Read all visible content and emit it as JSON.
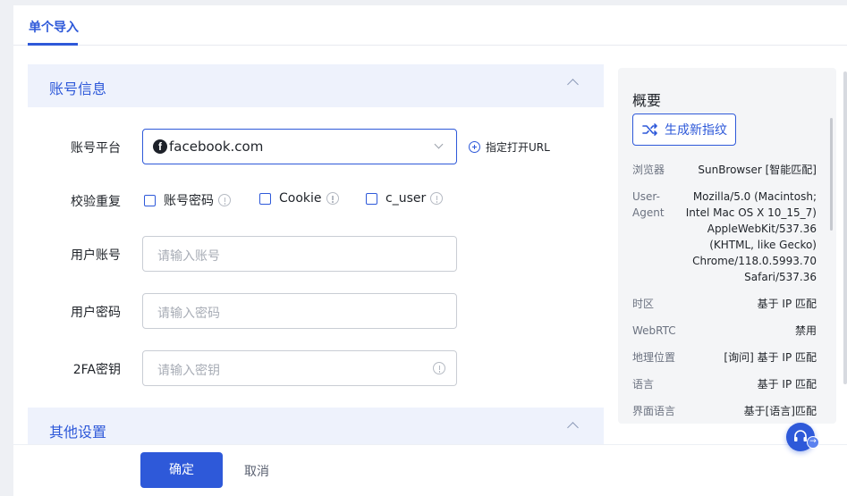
{
  "tabs": [
    {
      "label": "单个导入"
    }
  ],
  "account_section": {
    "title": "账号信息",
    "platform": {
      "label": "账号平台",
      "value": "facebook.com",
      "open_url": "指定打开URL"
    },
    "dedupe": {
      "label": "校验重复",
      "options": [
        {
          "label": "账号密码"
        },
        {
          "label": "Cookie"
        },
        {
          "label": "c_user"
        }
      ]
    },
    "username": {
      "label": "用户账号",
      "placeholder": "请输入账号"
    },
    "password": {
      "label": "用户密码",
      "placeholder": "请输入密码"
    },
    "twofa": {
      "label": "2FA密钥",
      "placeholder": "请输入密钥"
    }
  },
  "other_section": {
    "title": "其他设置"
  },
  "footer": {
    "ok": "确定",
    "cancel": "取消"
  },
  "summary": {
    "title": "概要",
    "generate": "生成新指纹",
    "rows": [
      {
        "key": "浏览器",
        "value": "SunBrowser [智能匹配]"
      },
      {
        "key": "User-Agent",
        "value": "Mozilla/5.0 (Macintosh; Intel Mac OS X 10_15_7) AppleWebKit/537.36 (KHTML, like Gecko) Chrome/118.0.5993.70 Safari/537.36"
      },
      {
        "key": "时区",
        "value": "基于 IP 匹配"
      },
      {
        "key": "WebRTC",
        "value": "禁用"
      },
      {
        "key": "地理位置",
        "value": "[询问] 基于 IP 匹配"
      },
      {
        "key": "语言",
        "value": "基于 IP 匹配"
      },
      {
        "key": "界面语言",
        "value": "基于[语言]匹配"
      }
    ]
  },
  "colors": {
    "accent": "#2e59d9",
    "section_bg": "#eef2fc"
  }
}
